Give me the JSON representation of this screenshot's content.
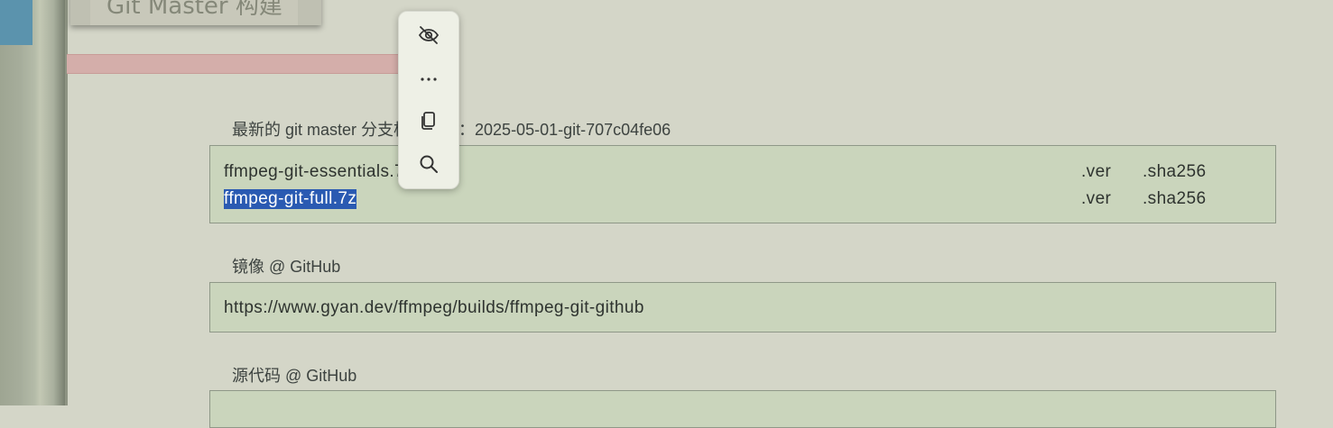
{
  "header": {
    "title": "Git Master 构建"
  },
  "latest": {
    "label": "最新的 git master 分支构建版本：2025-05-01-git-707c04fe06",
    "files": [
      {
        "name": "ffmpeg-git-essentials.7z",
        "ver": ".ver",
        "sha": ".sha256",
        "selected": false
      },
      {
        "name": "ffmpeg-git-full.7z",
        "ver": ".ver",
        "sha": ".sha256",
        "selected": true
      }
    ]
  },
  "mirror": {
    "label": "镜像 @ GitHub",
    "url": "https://www.gyan.dev/ffmpeg/builds/ffmpeg-git-github"
  },
  "source": {
    "label": "源代码 @ GitHub"
  },
  "popup": {
    "icons": [
      "eye-off-icon",
      "more-icon",
      "copy-icon",
      "search-icon"
    ]
  }
}
